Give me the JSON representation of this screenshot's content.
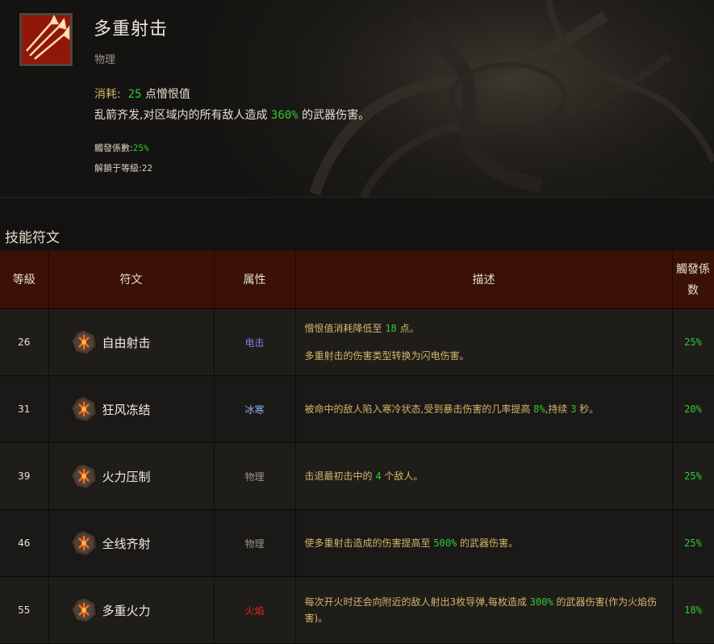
{
  "skill": {
    "name": "多重射击",
    "type": "物理",
    "cost_label": "消耗:",
    "cost_value": "25",
    "cost_unit": "点憎恨值",
    "desc_pre": "乱箭齐发,对区域内的所有敌人造成",
    "desc_value": "360%",
    "desc_post": "的武器伤害。",
    "proc_label": "觸發係數:",
    "proc_value": "25%",
    "unlock_label": "解鎖于等級:",
    "unlock_value": "22"
  },
  "runes_section": {
    "title": "技能符文",
    "headers": [
      "等級",
      "符文",
      "属性",
      "描述",
      "觸發係数"
    ],
    "rows": [
      {
        "level": "26",
        "name": "自由射击",
        "attr": "电击",
        "attr_color": "#7e7ef2",
        "desc": [
          [
            "憎恨值消耗降低至 ",
            "18",
            " 点。"
          ],
          [
            "多重射击的伤害类型转换为闪电伤害。",
            "",
            ""
          ]
        ],
        "rate": "25%"
      },
      {
        "level": "31",
        "name": "狂风冻结",
        "attr": "冰寒",
        "attr_color": "#8fb5ec",
        "desc": [
          [
            "被命中的敌人陷入寒冷状态,受到暴击伤害的几率提高 ",
            "8%",
            ",持续 ",
            "3",
            " 秒。"
          ]
        ],
        "rate": "20%"
      },
      {
        "level": "39",
        "name": "火力压制",
        "attr": "物理",
        "attr_color": "#9a9489",
        "desc": [
          [
            "击退最初击中的 ",
            "4",
            " 个敌人。"
          ]
        ],
        "rate": "25%"
      },
      {
        "level": "46",
        "name": "全线齐射",
        "attr": "物理",
        "attr_color": "#9a9489",
        "desc": [
          [
            "使多重射击造成的伤害提高至 ",
            "500%",
            " 的武器伤害。"
          ]
        ],
        "rate": "25%"
      },
      {
        "level": "55",
        "name": "多重火力",
        "attr": "火焰",
        "attr_color": "#e8241c",
        "desc": [
          [
            "每次开火时还会向附近的敌人射出3枚导弹,每枚造成 ",
            "300%",
            " 的武器伤害(作为火焰伤害)。"
          ]
        ],
        "rate": "18%"
      }
    ]
  }
}
